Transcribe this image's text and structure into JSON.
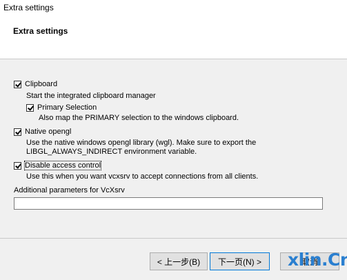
{
  "window": {
    "title": "Extra settings"
  },
  "header": {
    "title": "Extra settings"
  },
  "options": {
    "clipboard": {
      "label": "Clipboard",
      "checked": true,
      "desc": "Start the integrated clipboard manager"
    },
    "primary": {
      "label": "Primary Selection",
      "checked": true,
      "desc": "Also map the PRIMARY selection to the windows clipboard."
    },
    "opengl": {
      "label": "Native opengl",
      "checked": true,
      "desc1": "Use the native windows opengl library (wgl). Make sure to export the",
      "desc2": "LIBGL_ALWAYS_INDIRECT environment variable."
    },
    "access": {
      "label": "Disable access control",
      "checked": true,
      "desc": "Use this when you want vcxsrv to accept connections from all clients."
    }
  },
  "params": {
    "label": "Additional parameters for VcXsrv",
    "value": ""
  },
  "buttons": {
    "back": "< 上一步(B)",
    "next": "下一页(N) >",
    "cancel": "取消"
  },
  "watermark": "xlin.Cn"
}
